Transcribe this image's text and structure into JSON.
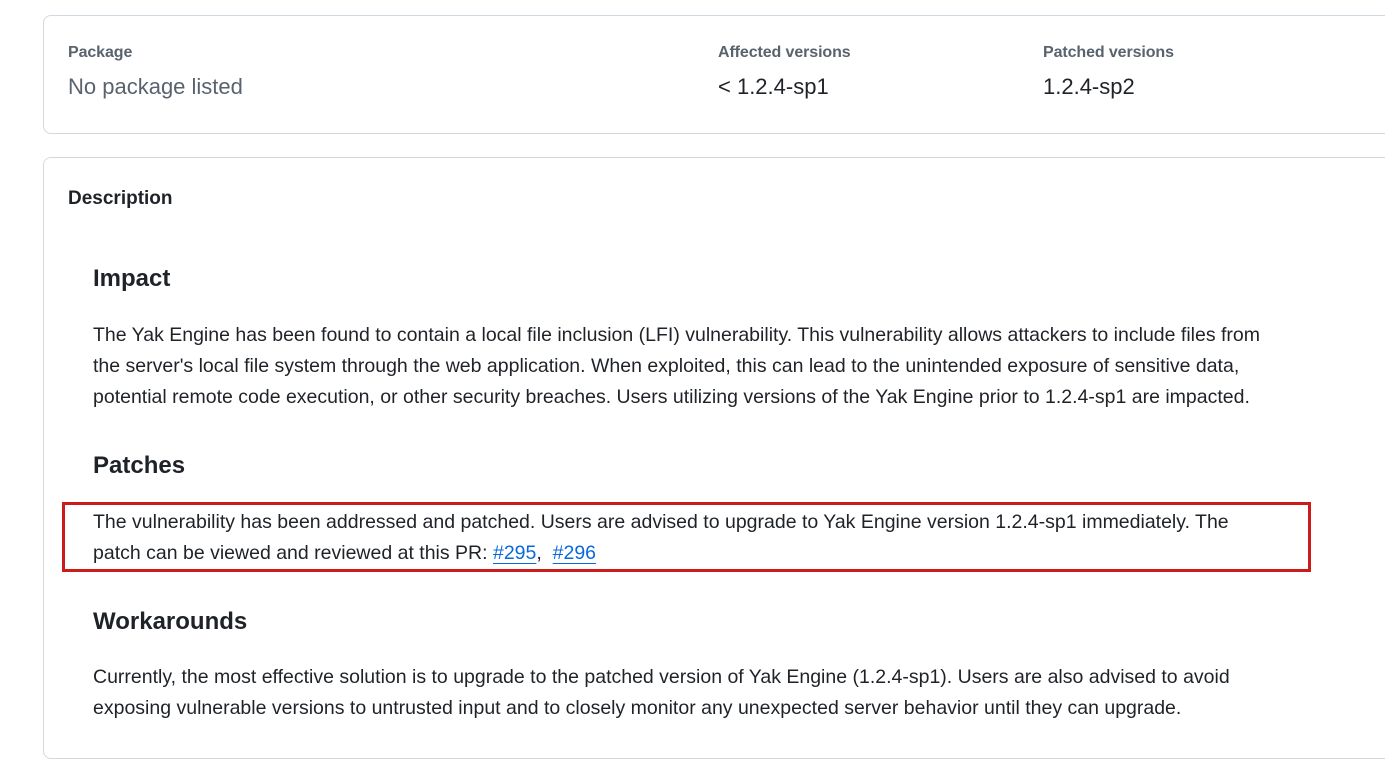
{
  "meta": {
    "package": {
      "label": "Package",
      "value": "No package listed"
    },
    "affected": {
      "label": "Affected versions",
      "value": "< 1.2.4-sp1"
    },
    "patched": {
      "label": "Patched versions",
      "value": "1.2.4-sp2"
    }
  },
  "description": {
    "title": "Description",
    "impact": {
      "heading": "Impact",
      "lines": [
        "The Yak Engine has been found to contain a local file inclusion (LFI) vulnerability. This vulnerability allows attackers to include files from",
        "the server's local file system through the web application. When exploited, this can lead to the unintended exposure of sensitive data,",
        "potential remote code execution, or other security breaches. Users utilizing versions of the Yak Engine prior to 1.2.4-sp1 are impacted."
      ]
    },
    "patches": {
      "heading": "Patches",
      "line1": "The vulnerability has been addressed and patched. Users are advised to upgrade to Yak Engine version 1.2.4-sp1 immediately. The",
      "line2_prefix": "patch can be viewed and reviewed at this PR: ",
      "links": [
        "#295",
        "#296"
      ],
      "separator": ", "
    },
    "workarounds": {
      "heading": "Workarounds",
      "lines": [
        "Currently, the most effective solution is to upgrade to the patched version of Yak Engine (1.2.4-sp1). Users are also advised to avoid",
        "exposing vulnerable versions to untrusted input and to closely monitor any unexpected server behavior until they can upgrade."
      ]
    }
  },
  "colors": {
    "link": "#0969da",
    "highlight_border": "#cc1b1b"
  }
}
